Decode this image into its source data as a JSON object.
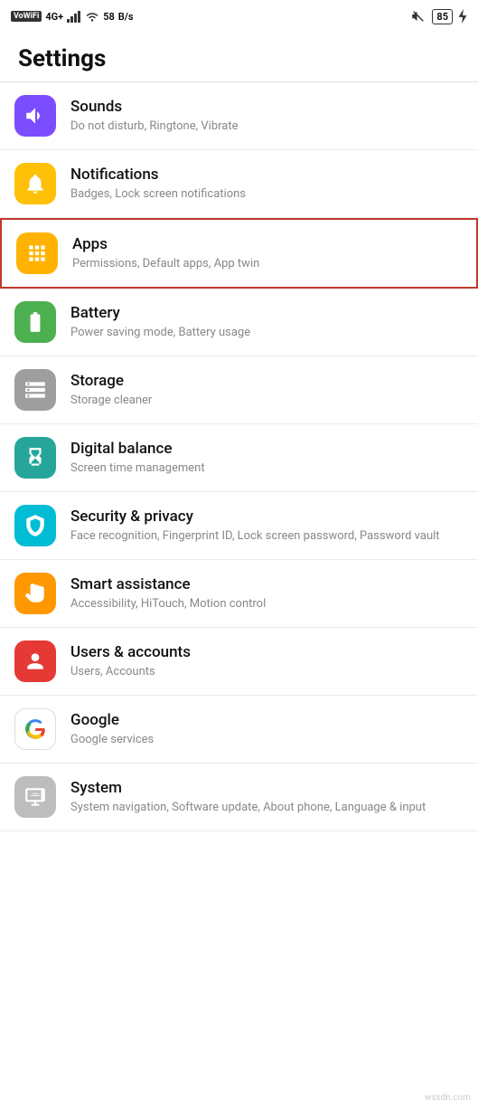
{
  "statusBar": {
    "left": {
      "wowifi": "VoWiFi",
      "network": "4G+",
      "signal": "signal",
      "wifi": "wifi",
      "speed": "58",
      "speedUnit": "B/s"
    },
    "right": {
      "mute": "mute",
      "battery": "85",
      "charge": "charging"
    }
  },
  "pageTitle": "Settings",
  "items": [
    {
      "id": "sounds",
      "title": "Sounds",
      "subtitle": "Do not disturb, Ringtone, Vibrate",
      "iconBg": "bg-purple",
      "iconType": "sound"
    },
    {
      "id": "notifications",
      "title": "Notifications",
      "subtitle": "Badges, Lock screen notifications",
      "iconBg": "bg-yellow",
      "iconType": "bell"
    },
    {
      "id": "apps",
      "title": "Apps",
      "subtitle": "Permissions, Default apps, App twin",
      "iconBg": "bg-yellow2",
      "iconType": "apps",
      "highlighted": true
    },
    {
      "id": "battery",
      "title": "Battery",
      "subtitle": "Power saving mode, Battery usage",
      "iconBg": "bg-green",
      "iconType": "battery"
    },
    {
      "id": "storage",
      "title": "Storage",
      "subtitle": "Storage cleaner",
      "iconBg": "bg-gray",
      "iconType": "storage"
    },
    {
      "id": "digital-balance",
      "title": "Digital balance",
      "subtitle": "Screen time management",
      "iconBg": "bg-teal",
      "iconType": "hourglass"
    },
    {
      "id": "security-privacy",
      "title": "Security & privacy",
      "subtitle": "Face recognition, Fingerprint ID, Lock screen password, Password vault",
      "iconBg": "bg-cyan",
      "iconType": "shield"
    },
    {
      "id": "smart-assistance",
      "title": "Smart assistance",
      "subtitle": "Accessibility, HiTouch, Motion control",
      "iconBg": "bg-orange",
      "iconType": "hand"
    },
    {
      "id": "users-accounts",
      "title": "Users & accounts",
      "subtitle": "Users, Accounts",
      "iconBg": "bg-red",
      "iconType": "user"
    },
    {
      "id": "google",
      "title": "Google",
      "subtitle": "Google services",
      "iconBg": "bg-white-border",
      "iconType": "google"
    },
    {
      "id": "system",
      "title": "System",
      "subtitle": "System navigation, Software update, About phone, Language & input",
      "iconBg": "bg-gray2",
      "iconType": "system"
    }
  ],
  "watermark": "wsxdn.com"
}
